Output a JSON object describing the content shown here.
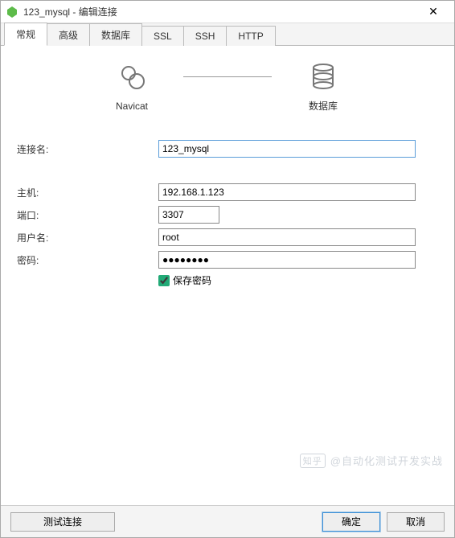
{
  "window": {
    "title": "123_mysql - 编辑连接",
    "close_glyph": "✕"
  },
  "tabs": [
    {
      "label": "常规",
      "active": true
    },
    {
      "label": "高级",
      "active": false
    },
    {
      "label": "数据库",
      "active": false
    },
    {
      "label": "SSL",
      "active": false
    },
    {
      "label": "SSH",
      "active": false
    },
    {
      "label": "HTTP",
      "active": false
    }
  ],
  "diagram": {
    "left_label": "Navicat",
    "right_label": "数据库"
  },
  "form": {
    "connection_name": {
      "label": "连接名:",
      "value": "123_mysql"
    },
    "host": {
      "label": "主机:",
      "value": "192.168.1.123"
    },
    "port": {
      "label": "端口:",
      "value": "3307"
    },
    "username": {
      "label": "用户名:",
      "value": "root"
    },
    "password": {
      "label": "密码:",
      "value": "●●●●●●●●"
    },
    "save_password": {
      "label": "保存密码",
      "checked": true
    }
  },
  "buttons": {
    "test": "测试连接",
    "ok": "确定",
    "cancel": "取消"
  },
  "watermark": {
    "badge_text": "知乎",
    "text": "@自动化测试开发实战"
  }
}
